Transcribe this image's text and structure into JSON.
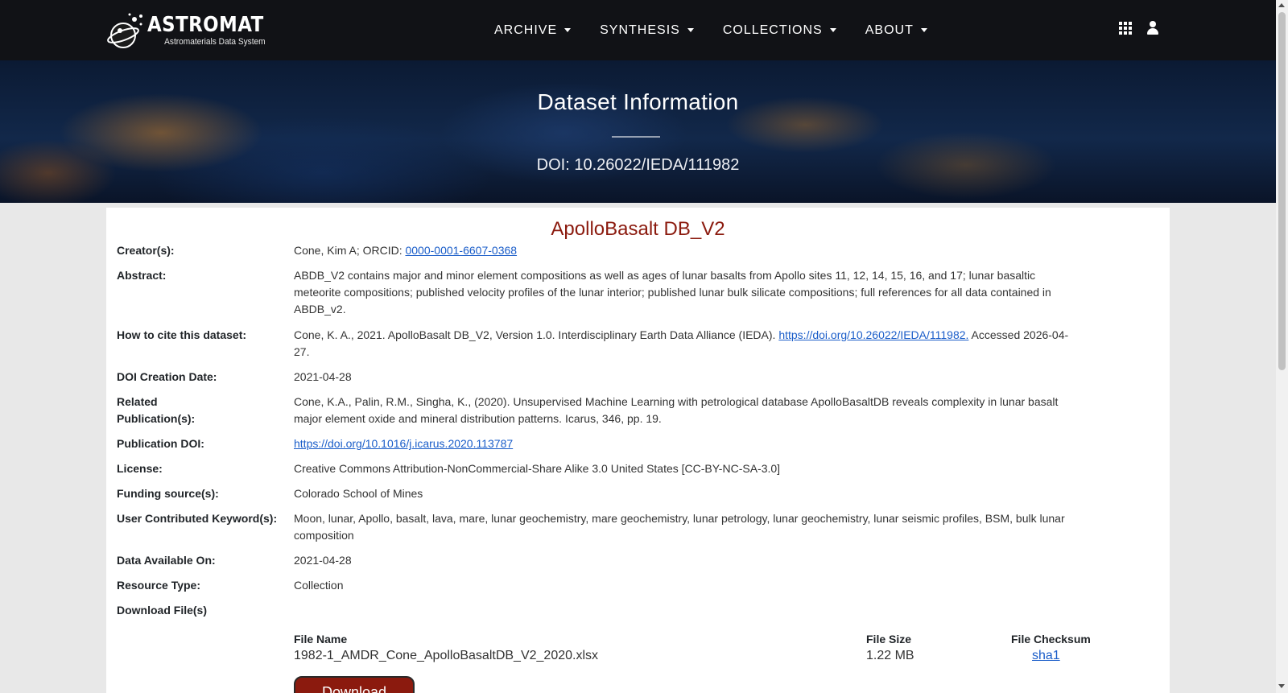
{
  "navbar": {
    "brand_title": "ASTROMAT",
    "brand_subtitle": "Astromaterials Data System",
    "menu": [
      {
        "label": "ARCHIVE"
      },
      {
        "label": "SYNTHESIS"
      },
      {
        "label": "COLLECTIONS"
      },
      {
        "label": "ABOUT"
      }
    ],
    "icons": [
      "apps-grid-icon",
      "user-icon"
    ]
  },
  "hero": {
    "title": "Dataset Information",
    "doi": "DOI: 10.26022/IEDA/111982"
  },
  "dataset": {
    "title": "ApolloBasalt DB_V2",
    "creator": {
      "label": "Creator(s):",
      "text": "Cone, Kim A; ORCID: ",
      "orcid": "0000-0001-6607-0368"
    },
    "abstract": {
      "label": "Abstract:",
      "text": "ABDB_V2 contains major and minor element compositions as well as ages of lunar basalts from Apollo sites 11, 12, 14, 15, 16, and 17; lunar basaltic meteorite compositions; published velocity profiles of the lunar interior; published lunar bulk silicate compositions; full references for all data contained in ABDB_v2."
    },
    "cite": {
      "label": "How to cite this dataset:",
      "text_before": "Cone, K. A., 2021. ApolloBasalt DB_V2, Version 1.0. Interdisciplinary Earth Data Alliance (IEDA). ",
      "link": "https://doi.org/10.26022/IEDA/111982.",
      "text_after": " Accessed 2026-04-27."
    },
    "doi_date": {
      "label": "DOI Creation Date:",
      "value": "2021-04-28"
    },
    "related_pub": {
      "label_line1": "Related",
      "label_line2": "Publication(s):",
      "value": "Cone, K.A., Palin, R.M., Singha, K., (2020). Unsupervised Machine Learning with petrological database ApolloBasaltDB reveals complexity in lunar basalt major element oxide and mineral distribution patterns. Icarus, 346, pp. 19."
    },
    "pub_doi": {
      "label": "Publication DOI:",
      "link": "https://doi.org/10.1016/j.icarus.2020.113787"
    },
    "license": {
      "label": "License:",
      "value": "Creative Commons Attribution-NonCommercial-Share Alike 3.0 United States [CC-BY-NC-SA-3.0]"
    },
    "funding": {
      "label": "Funding source(s):",
      "value": "Colorado School of Mines"
    },
    "keywords": {
      "label": "User Contributed Keyword(s):",
      "value": "Moon, lunar, Apollo, basalt, lava, mare, lunar geochemistry, mare geochemistry, lunar petrology, lunar geochemistry, lunar seismic profiles, BSM, bulk lunar composition"
    },
    "available": {
      "label": "Data Available On:",
      "value": "2021-04-28"
    },
    "resource": {
      "label": "Resource Type:",
      "value": "Collection"
    },
    "download": {
      "label": "Download File(s)",
      "col_name": "File Name",
      "col_size": "File Size",
      "col_checksum": "File Checksum",
      "file_name": "1982-1_AMDR_Cone_ApolloBasaltDB_V2_2020.xlsx",
      "file_size": "1.22 MB",
      "checksum_link": "sha1",
      "button_label": "Download"
    }
  },
  "colors": {
    "navbar_bg": "#111216",
    "title_accent": "#8b1a0e",
    "link": "#1a5dc9"
  }
}
